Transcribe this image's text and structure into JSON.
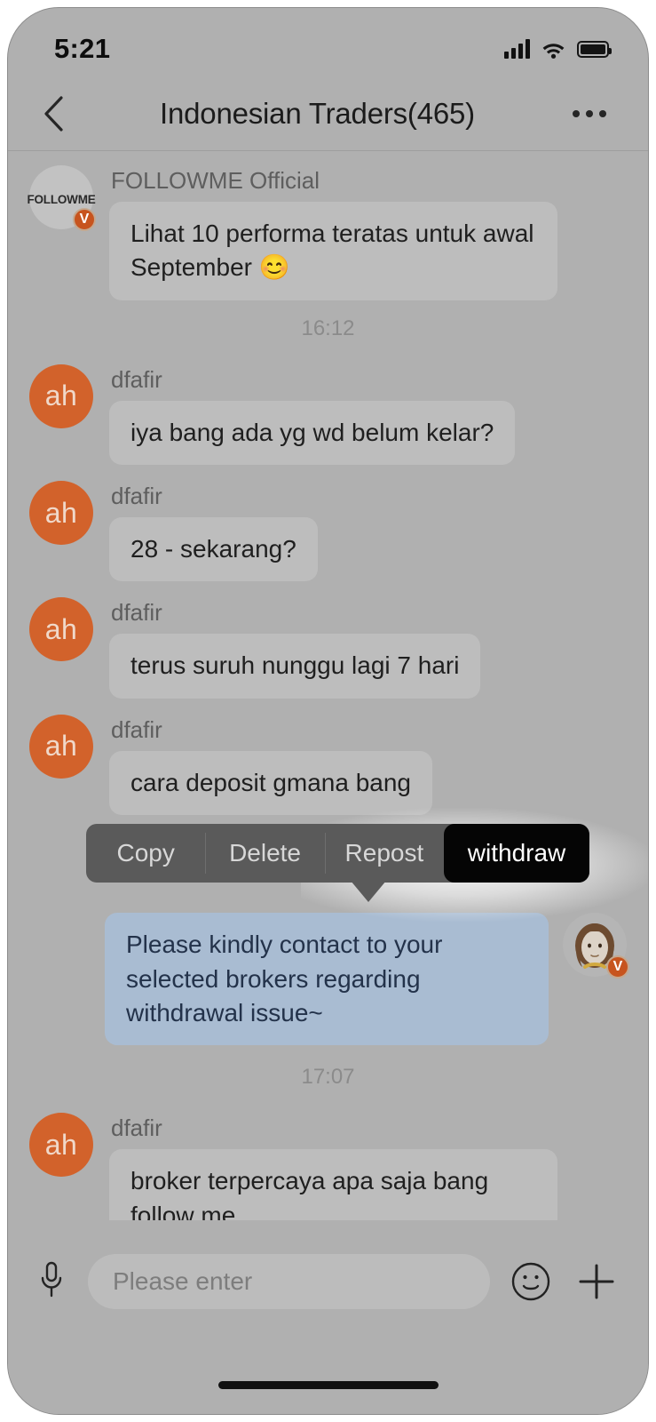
{
  "status_bar": {
    "time": "5:21",
    "signal_icon": "signal-bars-icon",
    "wifi_icon": "wifi-icon",
    "battery_icon": "battery-full-icon"
  },
  "header": {
    "back_icon": "chevron-left-icon",
    "title": "Indonesian Traders(465)",
    "more_icon": "more-horizontal-icon"
  },
  "messages": [
    {
      "sender": "FOLLOWME Official",
      "avatar_text": "FOLLOWME",
      "avatar_type": "brand",
      "verified": "V",
      "text": "Lihat 10 performa teratas untuk awal September 😊",
      "side": "in"
    },
    {
      "sender": "dfafir",
      "avatar_text": "ah",
      "avatar_type": "initials",
      "text": "iya bang ada yg wd belum kelar?",
      "side": "in"
    },
    {
      "sender": "dfafir",
      "avatar_text": "ah",
      "avatar_type": "initials",
      "text": "28  - sekarang?",
      "side": "in"
    },
    {
      "sender": "dfafir",
      "avatar_text": "ah",
      "avatar_type": "initials",
      "text": "terus suruh nunggu lagi 7 hari",
      "side": "in"
    },
    {
      "sender": "dfafir",
      "avatar_text": "ah",
      "avatar_type": "initials",
      "text": "cara deposit gmana bang",
      "side": "in"
    },
    {
      "sender": "",
      "avatar_type": "photo",
      "verified": "V",
      "text": "Please kindly contact to your selected brokers regarding withdrawal issue~",
      "side": "out"
    },
    {
      "sender": "dfafir",
      "avatar_text": "ah",
      "avatar_type": "initials",
      "text": "broker terpercaya apa saja bang follow me",
      "side": "in"
    }
  ],
  "timestamps": {
    "first": "16:12",
    "second": "17:07"
  },
  "context_menu": {
    "items": [
      {
        "label": "Copy",
        "active": false
      },
      {
        "label": "Delete",
        "active": false
      },
      {
        "label": "Repost",
        "active": false
      },
      {
        "label": "withdraw",
        "active": true
      }
    ]
  },
  "input_bar": {
    "mic_icon": "microphone-icon",
    "placeholder": "Please enter",
    "value": "",
    "emoji_icon": "smiley-face-icon",
    "plus_icon": "plus-icon"
  },
  "colors": {
    "app_background": "#b0b0b0",
    "bubble_in": "#bdbdbd",
    "bubble_out": "#a9bcd2",
    "avatar_orange": "#d2622b",
    "menu_background": "#5a5a5a",
    "menu_active": "#050505",
    "verified_badge": "#c7541e"
  }
}
